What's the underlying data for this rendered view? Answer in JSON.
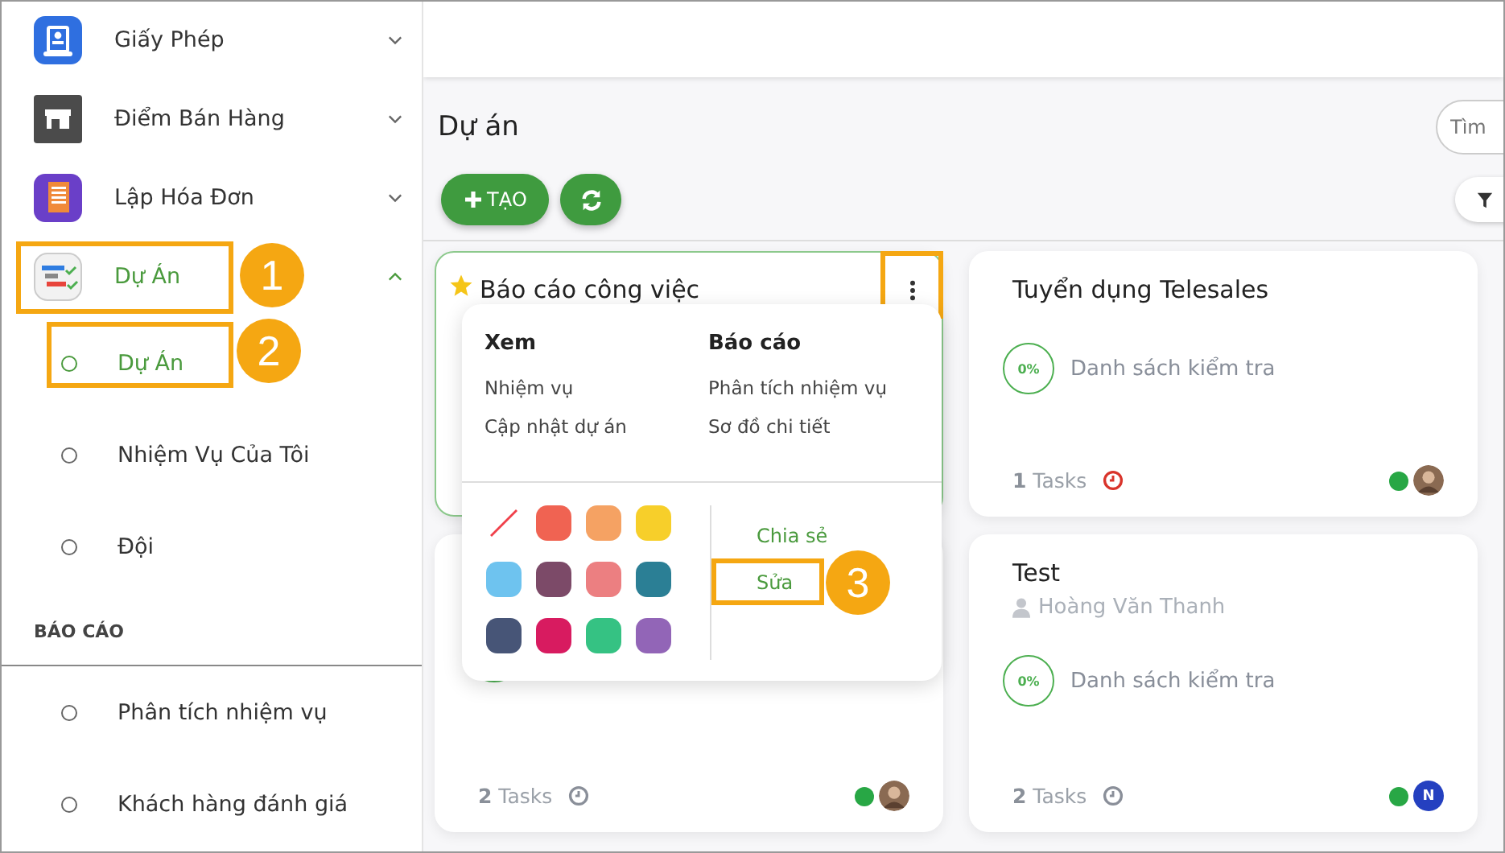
{
  "sidebar": {
    "items": [
      {
        "label": "Giấy Phép",
        "expanded": false,
        "selected": false
      },
      {
        "label": "Điểm Bán Hàng",
        "expanded": false,
        "selected": false
      },
      {
        "label": "Lập Hóa Đơn",
        "expanded": false,
        "selected": false
      },
      {
        "label": "Dự Án",
        "expanded": true,
        "selected": true,
        "callout": "1",
        "children": [
          {
            "label": "Dự Án",
            "selected": true,
            "callout": "2"
          },
          {
            "label": "Nhiệm Vụ Của Tôi",
            "selected": false
          },
          {
            "label": "Đội",
            "selected": false
          }
        ]
      }
    ],
    "section": {
      "title": "BÁO CÁO",
      "items": [
        {
          "label": "Phân tích nhiệm vụ",
          "selected": false
        },
        {
          "label": "Khách hàng đánh giá",
          "selected": false
        }
      ]
    }
  },
  "page": {
    "title": "Dự án",
    "search": {
      "placeholder": "Tìm"
    },
    "create_button": "TẠO"
  },
  "cards": [
    {
      "title": "Báo cáo công việc",
      "starred": true,
      "selected": true,
      "menu_open": true
    },
    {
      "starred": false,
      "selected": false,
      "menu_open": false,
      "progress_ring": true,
      "tasks": "**2** Tasks",
      "overdue": false,
      "color": "#28a745",
      "avatar": {
        "kind": "photo"
      }
    },
    {
      "title": "Tuyển dụng Telesales",
      "starred": false,
      "selected": false,
      "menu_open": false,
      "progress": {
        "value": "0%",
        "label": "Danh sách kiểm tra"
      },
      "tasks": "**1** Tasks",
      "overdue": true,
      "color": "#28a745",
      "avatar": {
        "kind": "photo"
      }
    },
    {
      "title": "Test",
      "owner": "Hoàng Văn Thanh",
      "starred": false,
      "selected": false,
      "menu_open": false,
      "progress": {
        "value": "0%",
        "label": "Danh sách kiểm tra"
      },
      "tasks": "**2** Tasks",
      "overdue": false,
      "color": "#28a745",
      "avatar": {
        "kind": "initial",
        "text": "N"
      }
    }
  ],
  "card_menu": {
    "columns": [
      {
        "title": "Xem",
        "items": [
          "Nhiệm vụ",
          "Cập nhật dự án"
        ]
      },
      {
        "title": "Báo cáo",
        "items": [
          "Phân tích nhiệm vụ",
          "Sơ đồ chi tiết"
        ]
      }
    ],
    "swatches": [
      {
        "kind": "none"
      },
      {
        "kind": "color",
        "color": "#f06352"
      },
      {
        "kind": "color",
        "color": "#f5a263"
      },
      {
        "kind": "color",
        "color": "#f7cf2a"
      },
      {
        "kind": "color",
        "color": "#6ec3ef"
      },
      {
        "kind": "color",
        "color": "#7c4a68"
      },
      {
        "kind": "color",
        "color": "#ec7f81"
      },
      {
        "kind": "color",
        "color": "#2b7f95"
      },
      {
        "kind": "color",
        "color": "#475577"
      },
      {
        "kind": "color",
        "color": "#d81b60"
      },
      {
        "kind": "color",
        "color": "#35c283"
      },
      {
        "kind": "color",
        "color": "#9265b7"
      }
    ],
    "actions": [
      {
        "label": "Chia sẻ"
      },
      {
        "label": "Sửa",
        "callout": "3"
      }
    ]
  }
}
